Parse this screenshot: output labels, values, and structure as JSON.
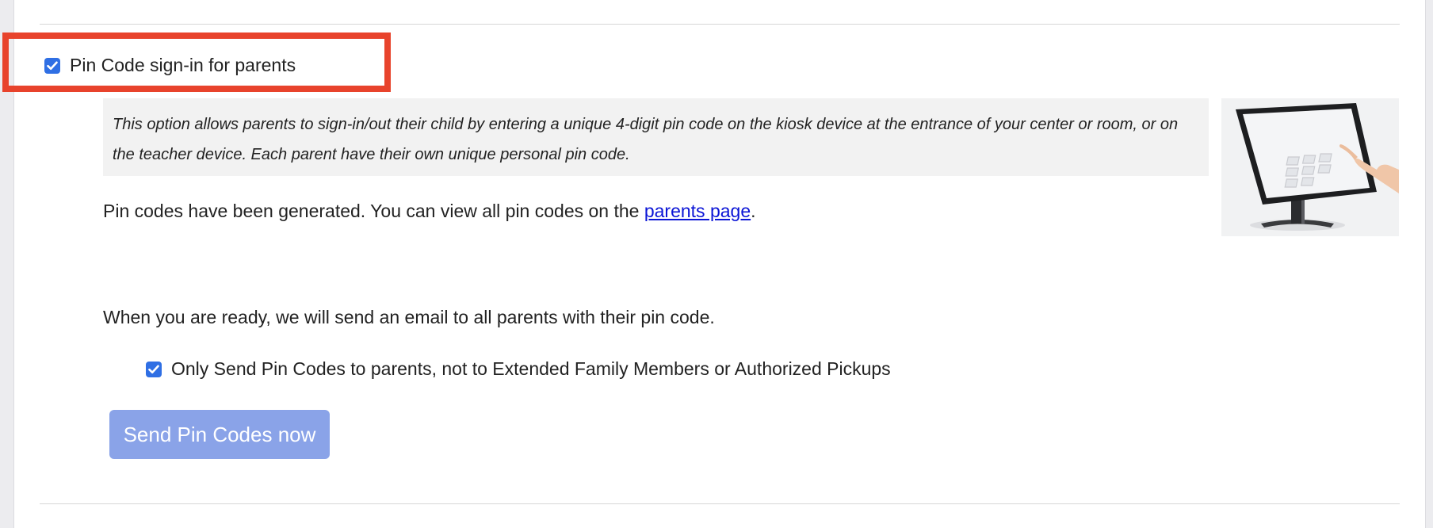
{
  "pin_code_option": {
    "label": "Pin Code sign-in for parents",
    "checked": true,
    "highlight_color": "#e8432c"
  },
  "description": "This option allows parents to sign-in/out their child by entering a unique 4-digit pin code on the kiosk device at the entrance of your center or room, or on the teacher device. Each parent have their own unique personal pin code.",
  "generated": {
    "text_before": "Pin codes have been generated. You can view all pin codes on the ",
    "link_text": "parents page",
    "text_after": "."
  },
  "ready_text": "When you are ready, we will send an email to all parents with their pin code.",
  "only_parents_option": {
    "label": "Only Send Pin Codes to parents, not to Extended Family Members or Authorized Pickups",
    "checked": true
  },
  "send_button": {
    "label": "Send Pin Codes now",
    "color": "#8aa3e8"
  },
  "colors": {
    "checkbox": "#2f6fe4",
    "link": "#0a14d6",
    "description_bg": "#f2f2f2"
  },
  "kiosk_image": {
    "icon": "kiosk-tablet-image"
  }
}
